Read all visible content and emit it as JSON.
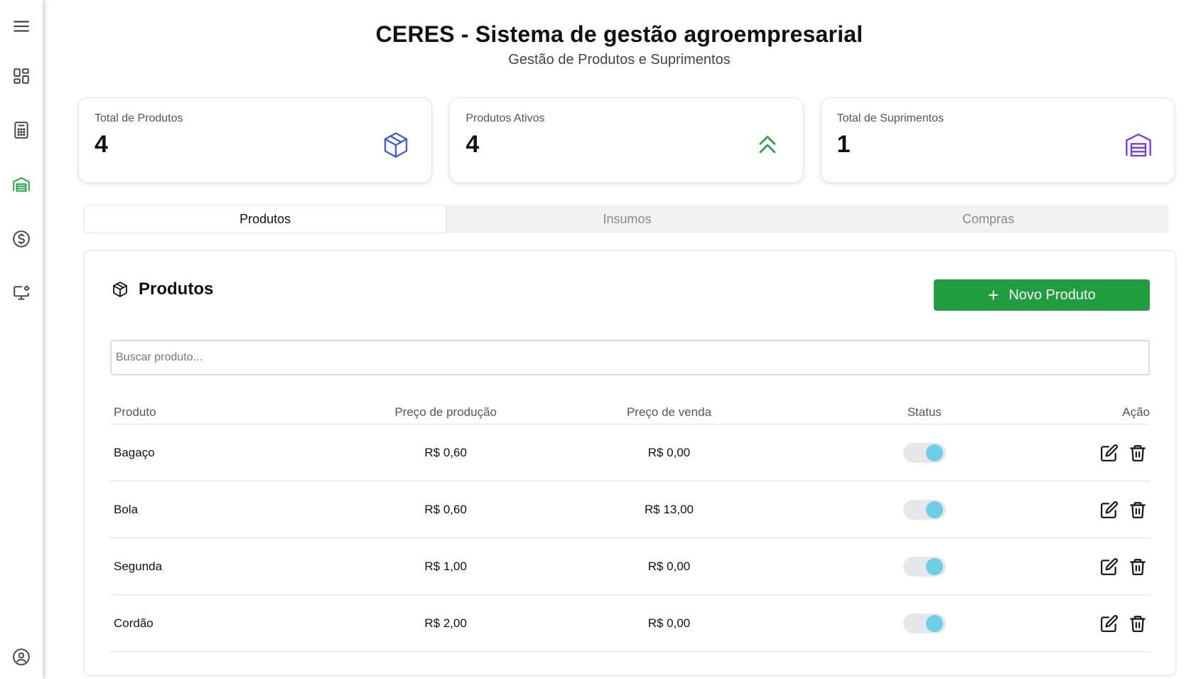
{
  "sidebar": {
    "items": [
      {
        "icon": "menu-icon"
      },
      {
        "icon": "dashboard-icon"
      },
      {
        "icon": "calculator-icon"
      },
      {
        "icon": "warehouse-icon",
        "active": true,
        "color": "#22a745"
      },
      {
        "icon": "dollar-icon"
      },
      {
        "icon": "monitor-settings-icon"
      },
      {
        "icon": "user-circle-icon"
      }
    ]
  },
  "header": {
    "title": "CERES - Sistema de gestão agroempresarial",
    "subtitle": "Gestão de Produtos e Suprimentos"
  },
  "stats": [
    {
      "label": "Total de Produtos",
      "value": "4",
      "icon": "box-icon",
      "color": "#3b5bdb"
    },
    {
      "label": "Produtos Ativos",
      "value": "4",
      "icon": "chevrons-up-icon",
      "color": "#22a745"
    },
    {
      "label": "Total de Suprimentos",
      "value": "1",
      "icon": "warehouse-icon",
      "color": "#7c3aed"
    }
  ],
  "tabs": [
    {
      "label": "Produtos",
      "active": true
    },
    {
      "label": "Insumos",
      "active": false
    },
    {
      "label": "Compras",
      "active": false
    }
  ],
  "panel": {
    "title": "Produtos",
    "new_button": "Novo Produto",
    "search_placeholder": "Buscar produto..."
  },
  "table": {
    "headers": [
      "Produto",
      "Preço de produção",
      "Preço de venda",
      "Status",
      "Ação"
    ],
    "rows": [
      {
        "name": "Bagaço",
        "production_price": "R$ 0,60",
        "sale_price": "R$ 0,00",
        "active": true
      },
      {
        "name": "Bola",
        "production_price": "R$ 0,60",
        "sale_price": "R$ 13,00",
        "active": true
      },
      {
        "name": "Segunda",
        "production_price": "R$ 1,00",
        "sale_price": "R$ 0,00",
        "active": true
      },
      {
        "name": "Cordão",
        "production_price": "R$ 2,00",
        "sale_price": "R$ 0,00",
        "active": true
      }
    ]
  },
  "colors": {
    "primary_green": "#1f9d3f",
    "toggle_knob": "#6ccfe6"
  }
}
